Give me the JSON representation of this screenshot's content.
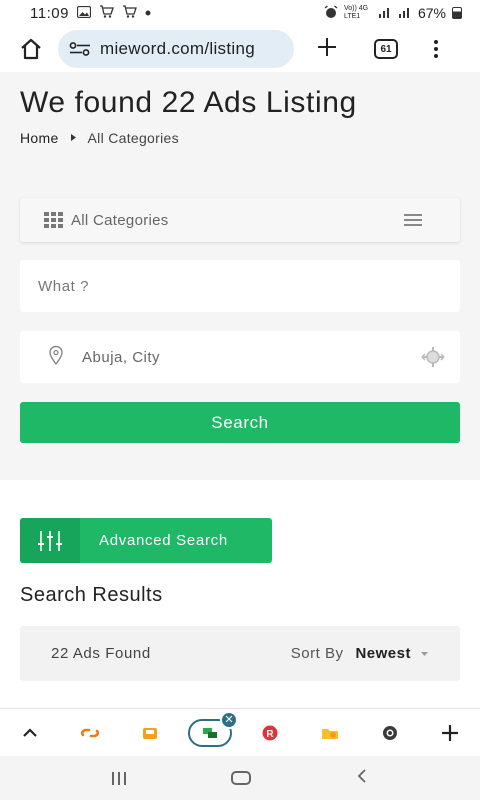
{
  "status_bar": {
    "time": "11:09",
    "network_label": "Vo)) 4G LTE1",
    "battery_text": "67%"
  },
  "browser": {
    "url": "mieword.com/listing",
    "tab_count": "61"
  },
  "page": {
    "title": "We found 22 Ads Listing",
    "breadcrumb": {
      "home": "Home",
      "current": "All Categories"
    }
  },
  "search_form": {
    "category_label": "All Categories",
    "what_placeholder": "What ?",
    "location_value": "Abuja, City",
    "search_button": "Search"
  },
  "advanced_search_label": "Advanced Search",
  "results": {
    "heading": "Search Results",
    "count_text": "22 Ads Found",
    "sort_label": "Sort By",
    "sort_value": "Newest"
  },
  "colors": {
    "accent_green": "#1eb866",
    "accent_green_dark": "#16a55a",
    "url_pill": "#e3edf6",
    "active_tab_border": "#2d6f86"
  },
  "tab_strip": {
    "items": [
      "chevron-up-icon",
      "orange-link-favicon",
      "orange-folder-favicon",
      "active-green-tab",
      "red-r-favicon",
      "yellow-folder-favicon",
      "dark-circle-favicon",
      "plus-icon"
    ]
  }
}
